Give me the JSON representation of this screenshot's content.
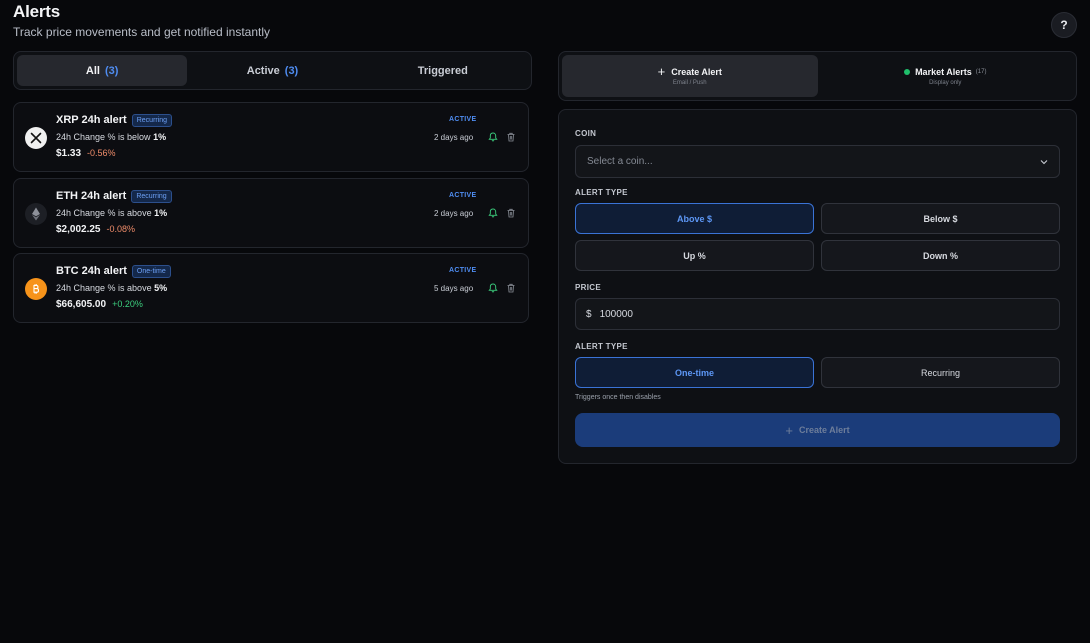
{
  "header": {
    "title": "Alerts",
    "subtitle": "Track price movements and get notified instantly",
    "help_label": "?"
  },
  "filter_tabs": [
    {
      "label": "All",
      "count": "(3)",
      "selected": true
    },
    {
      "label": "Active",
      "count": "(3)",
      "selected": false
    },
    {
      "label": "Triggered",
      "count": "",
      "selected": false
    }
  ],
  "alerts": [
    {
      "name": "XRP 24h alert",
      "badge": "Recurring",
      "condition_prefix": "24h Change % is below ",
      "condition_value": "1%",
      "price": "$1.33",
      "change": "-0.56%",
      "status": "ACTIVE",
      "ago": "2 days ago",
      "icon": "xrp-icon"
    },
    {
      "name": "ETH 24h alert",
      "badge": "Recurring",
      "condition_prefix": "24h Change % is above ",
      "condition_value": "1%",
      "price": "$2,002.25",
      "change": "-0.08%",
      "status": "ACTIVE",
      "ago": "2 days ago",
      "icon": "eth-icon"
    },
    {
      "name": "BTC 24h alert",
      "badge": "One-time",
      "condition_prefix": "24h Change % is above ",
      "condition_value": "5%",
      "price": "$66,605.00",
      "change": "+0.20%",
      "status": "ACTIVE",
      "ago": "5 days ago",
      "icon": "btc-icon"
    }
  ],
  "mode_tabs": {
    "create": {
      "title": "Create Alert",
      "sub": "Email / Push"
    },
    "market": {
      "title": "Market Alerts",
      "count": "(17)",
      "sub": "Display only"
    }
  },
  "form": {
    "coin_label": "COIN",
    "coin_placeholder": "Select a coin...",
    "alert_type_label": "ALERT TYPE",
    "type_options": [
      "Above $",
      "Below $",
      "Up %",
      "Down %"
    ],
    "price_label": "PRICE",
    "currency_symbol": "$",
    "price_value": "100000",
    "frequency_label": "ALERT TYPE",
    "frequency_options": [
      "One-time",
      "Recurring"
    ],
    "hint": "Triggers once then disables",
    "submit_label": "Create Alert"
  },
  "colors": {
    "accent": "#4f8df2",
    "negative": "#ef8c6a",
    "positive": "#3ccf7e",
    "btc": "#f7931a"
  }
}
